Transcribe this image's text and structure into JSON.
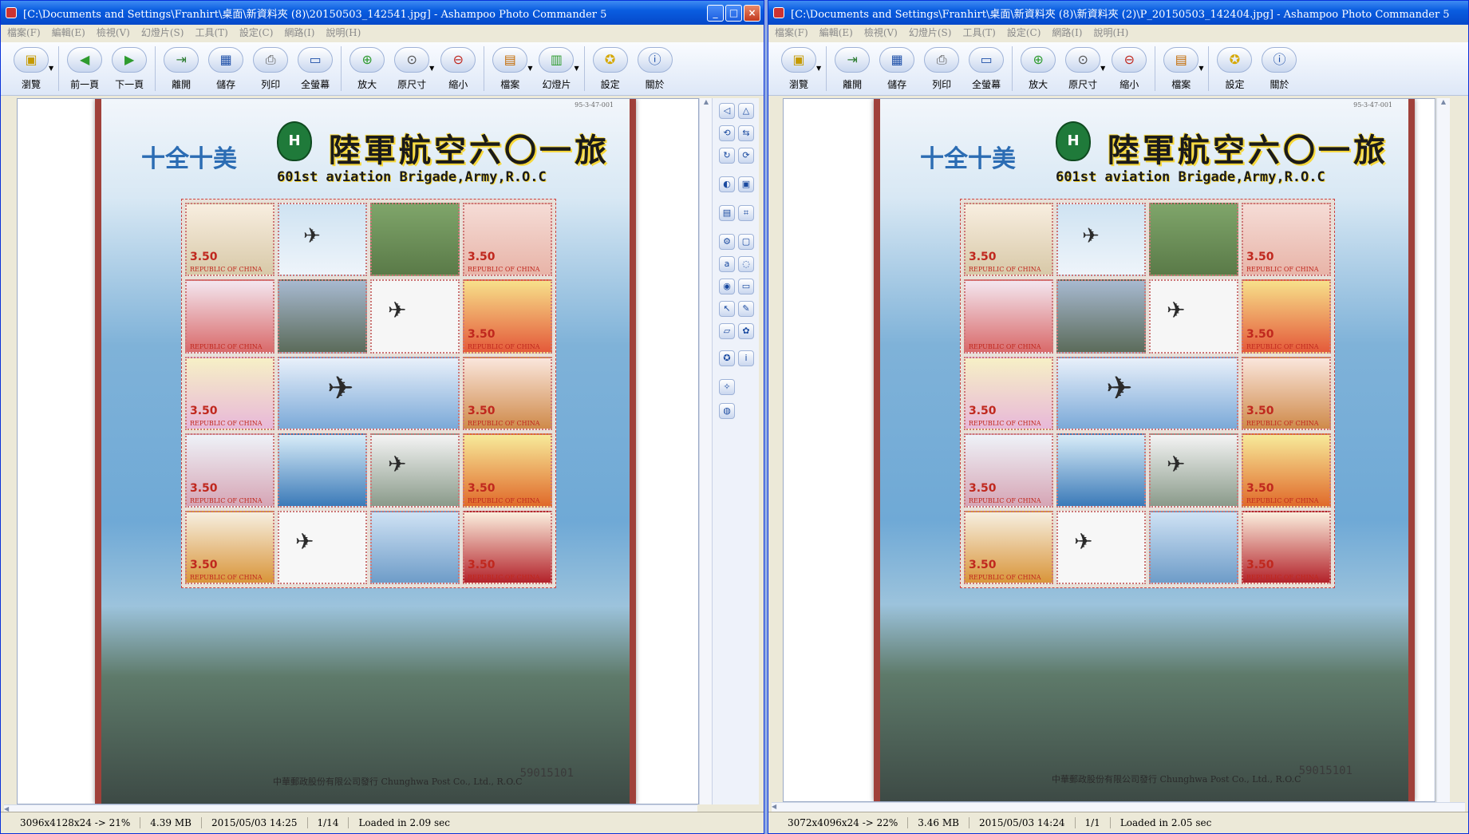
{
  "left": {
    "title": "[C:\\Documents and Settings\\Franhirt\\桌面\\新資料夾 (8)\\20150503_142541.jpg] - Ashampoo Photo Commander 5",
    "menu": [
      "檔案(F)",
      "編輯(E)",
      "檢視(V)",
      "幻燈片(S)",
      "工具(T)",
      "設定(C)",
      "網路(I)",
      "說明(H)"
    ],
    "toolbar": [
      "瀏覽",
      "前一頁",
      "下一頁",
      "離開",
      "儲存",
      "列印",
      "全螢幕",
      "放大",
      "原尺寸",
      "縮小",
      "檔案",
      "幻燈片",
      "設定",
      "關於"
    ],
    "status": [
      "3096x4128x24 -> 21%",
      "4.39 MB",
      "2015/05/03 14:25",
      "1/14",
      "Loaded in 2.09 sec"
    ]
  },
  "right": {
    "title": "[C:\\Documents and Settings\\Franhirt\\桌面\\新資料夾 (8)\\新資料夾 (2)\\P_20150503_142404.jpg] - Ashampoo Photo Commander 5",
    "menu": [
      "檔案(F)",
      "編輯(E)",
      "檢視(V)",
      "幻燈片(S)",
      "工具(T)",
      "設定(C)",
      "網路(I)",
      "說明(H)"
    ],
    "toolbar": [
      "瀏覽",
      "離開",
      "儲存",
      "列印",
      "全螢幕",
      "放大",
      "原尺寸",
      "縮小",
      "檔案",
      "設定",
      "關於"
    ],
    "status": [
      "3072x4096x24 -> 22%",
      "3.46 MB",
      "2015/05/03 14:24",
      "1/1",
      "Loaded in 2.05 sec"
    ]
  },
  "sheet": {
    "brand": "十全十美",
    "title": "陸軍航空六〇一旅",
    "subtitle": "601st aviation Brigade,Army,R.O.C",
    "denomination": "3.50",
    "republic": "REPUBLIC OF CHINA",
    "serial": "59015101",
    "publisher": "中華郵政股份有限公司發行 Chunghwa Post Co., Ltd., R.O.C"
  },
  "colors": {
    "title_active": "#0a5de0",
    "sheet_border": "#a0413a",
    "stamp_red": "#c0281e"
  },
  "icons": {
    "left_toolbar": [
      "browse-icon",
      "prev-arrow-icon",
      "next-arrow-icon",
      "exit-icon",
      "save-icon",
      "print-icon",
      "fullscreen-icon",
      "zoom-in-icon",
      "actual-size-icon",
      "zoom-out-icon",
      "file-icon",
      "slideshow-icon",
      "settings-icon",
      "about-icon"
    ],
    "right_toolbar": [
      "browse-icon",
      "exit-icon",
      "save-icon",
      "print-icon",
      "fullscreen-icon",
      "zoom-in-icon",
      "actual-size-icon",
      "zoom-out-icon",
      "file-icon",
      "settings-icon",
      "about-icon"
    ],
    "window_buttons": [
      "minimize-icon",
      "maximize-icon",
      "close-icon"
    ]
  }
}
